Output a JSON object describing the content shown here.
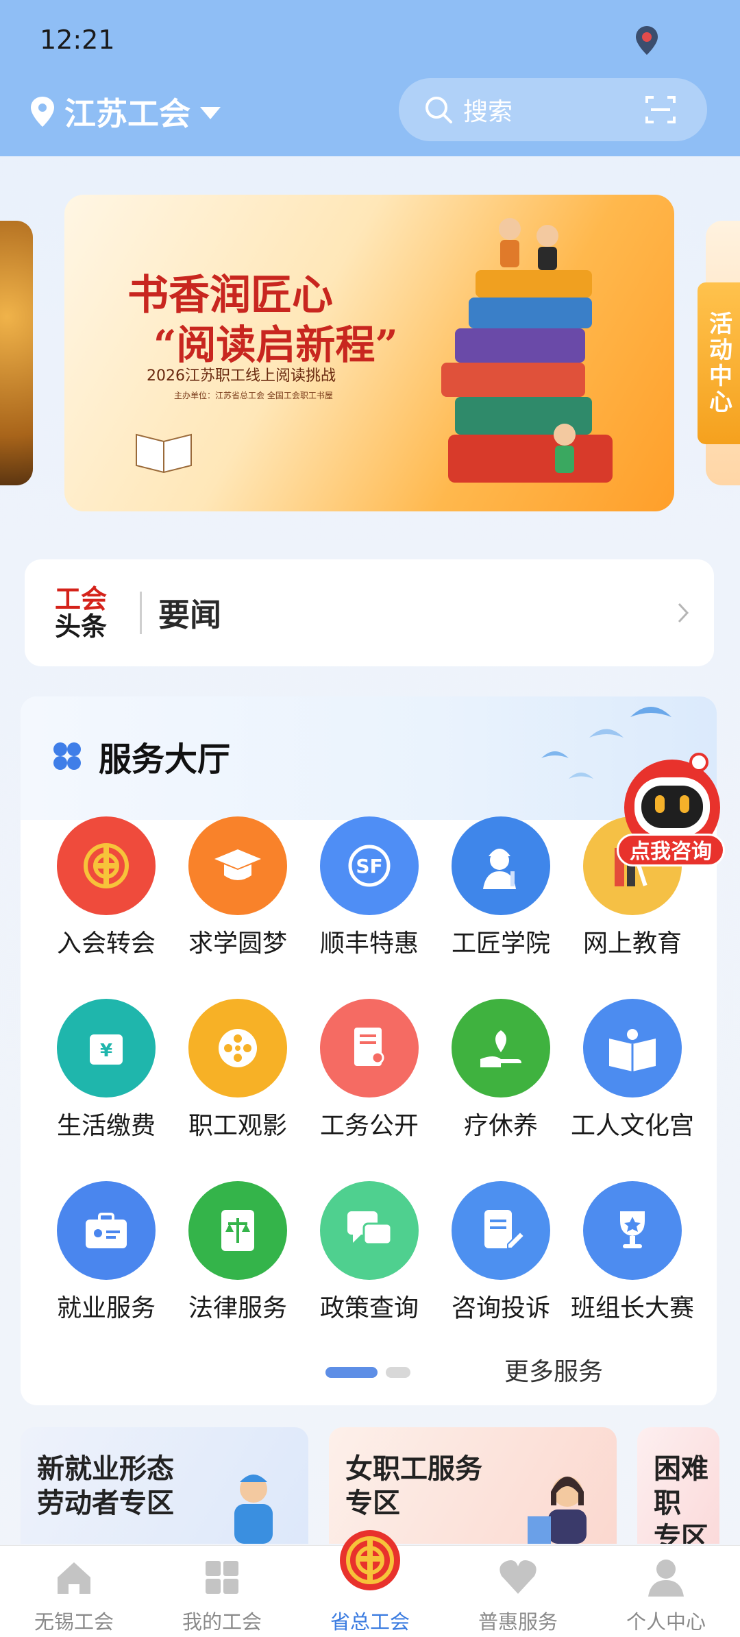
{
  "status_bar": {
    "time": "12:21"
  },
  "header": {
    "location": "江苏工会",
    "search_placeholder": "搜索"
  },
  "banner": {
    "title_line1": "书香润匠心",
    "title_line2": "“阅读启新程”",
    "subtitle": "2026江苏职工线上阅读挑战",
    "sponsor": "主办单位：江苏省总工会  全国工会职工书屋",
    "side_tab": "活动中心"
  },
  "news": {
    "logo_line1": "工会",
    "logo_line2": "头条",
    "text": "要闻"
  },
  "service_hall": {
    "title": "服务大厅",
    "rows": [
      [
        {
          "label": "入会转会",
          "icon": "union-emblem-icon",
          "color": "#ef4b3c"
        },
        {
          "label": "求学圆梦",
          "icon": "graduation-cap-icon",
          "color": "#f9822a"
        },
        {
          "label": "顺丰特惠",
          "icon": "sf-express-icon",
          "color": "#4f8ef5"
        },
        {
          "label": "工匠学院",
          "icon": "craftsman-icon",
          "color": "#3f86ea"
        },
        {
          "label": "网上教育",
          "icon": "books-icon",
          "color": "#f5c045"
        }
      ],
      [
        {
          "label": "生活缴费",
          "icon": "wallet-icon",
          "color": "#1fb6ac"
        },
        {
          "label": "职工观影",
          "icon": "film-reel-icon",
          "color": "#f7b126"
        },
        {
          "label": "工务公开",
          "icon": "document-person-icon",
          "color": "#f56b63"
        },
        {
          "label": "疗休养",
          "icon": "hand-leaf-icon",
          "color": "#3fb23f"
        },
        {
          "label": "工人文化宫",
          "icon": "open-book-icon",
          "color": "#4c8cf0"
        }
      ],
      [
        {
          "label": "就业服务",
          "icon": "briefcase-icon",
          "color": "#4a86ee"
        },
        {
          "label": "法律服务",
          "icon": "law-book-icon",
          "color": "#34b44a"
        },
        {
          "label": "政策查询",
          "icon": "chat-bubbles-icon",
          "color": "#4fd08f"
        },
        {
          "label": "咨询投诉",
          "icon": "edit-document-icon",
          "color": "#4d90f0"
        },
        {
          "label": "班组长大赛",
          "icon": "trophy-icon",
          "color": "#4d8cf0"
        }
      ]
    ],
    "more": "更多服务",
    "pager": {
      "current": 1,
      "total": 2
    }
  },
  "consult_robot": {
    "label": "点我咨询"
  },
  "zones": [
    {
      "title_line1": "新就业形态",
      "title_line2": "劳动者专区"
    },
    {
      "title_line1": "女职工服务",
      "title_line2": "专区"
    },
    {
      "title_line1": "困难职",
      "title_line2": "专区"
    }
  ],
  "bottom_nav": [
    {
      "label": "无锡工会",
      "icon": "home-icon",
      "active": false
    },
    {
      "label": "我的工会",
      "icon": "grid-icon",
      "active": false
    },
    {
      "label": "省总工会",
      "icon": "union-emblem-icon",
      "active": true
    },
    {
      "label": "普惠服务",
      "icon": "heart-icon",
      "active": false
    },
    {
      "label": "个人中心",
      "icon": "person-icon",
      "active": false
    }
  ],
  "colors": {
    "header_bg": "#8fbef5",
    "accent_blue": "#3a7be0",
    "union_red": "#d4221a"
  }
}
